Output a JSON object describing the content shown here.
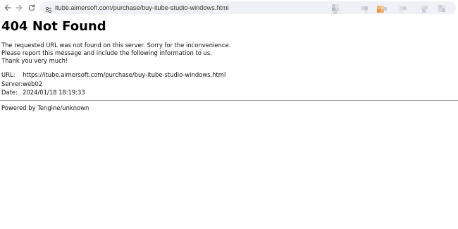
{
  "browser": {
    "url": "itube.aimersoft.com/purchase/buy-itube-studio-windows.html",
    "extension_icons": [
      "extension-icon",
      "extension-icon",
      "extension-icon",
      "extension-icon",
      "extension-icon",
      "extension-icon"
    ]
  },
  "page": {
    "heading": "404 Not Found",
    "message_lines": [
      "The requested URL was not found on this server. Sorry for the inconvenience.",
      "Please report this message and include the following information to us.",
      "Thank you very much!"
    ],
    "info": [
      {
        "label": "URL:",
        "value": "https://itube.aimersoft.com/purchase/buy-itube-studio-windows.html"
      },
      {
        "label": "Server:",
        "value": "web02"
      },
      {
        "label": "Date:",
        "value": "2024/01/18 18:19:33"
      }
    ],
    "footer": "Powered by Tengine/unknown"
  },
  "colors": {
    "omnibox_bg": "#eef1f5",
    "separator": "#9a9a9a"
  }
}
